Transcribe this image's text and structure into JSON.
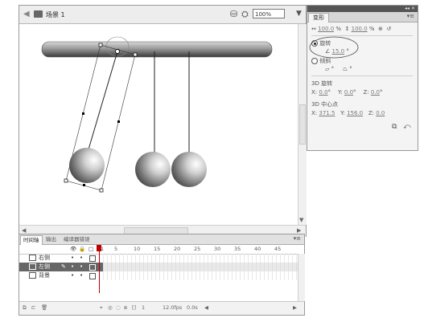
{
  "stage": {
    "back_icon": "arrow-back-icon",
    "scene_label": "场景 1",
    "zoom_value": "100%",
    "edit_symbol_icon": "edit-symbols-icon",
    "edit_scene_icon": "edit-scene-icon",
    "dropdown_icon": "chevron-down-icon"
  },
  "transform_panel": {
    "tab_label": "变形",
    "width_scale": "100.0",
    "height_scale": "100.0",
    "percent": "%",
    "rotate_label": "旋转",
    "rotate_value": "15.0",
    "degree": "°",
    "skew_label": "倾斜",
    "skew_h_value": "",
    "skew_v_value": "",
    "rotation3d_label": "3D 旋转",
    "rot_x_label": "X:",
    "rot_x_value": "0.0",
    "rot_y_label": "Y:",
    "rot_y_value": "0.0",
    "rot_z_label": "Z:",
    "rot_z_value": "0.0",
    "center3d_label": "3D 中心点",
    "center_x_label": "X:",
    "center_x_value": "371.5",
    "center_y_label": "Y:",
    "center_y_value": "156.0",
    "center_z_label": "Z:",
    "center_z_value": "0.0"
  },
  "timeline": {
    "tabs": [
      "时间轴",
      "输出",
      "编译器错误"
    ],
    "frame_numbers": [
      "1",
      "5",
      "10",
      "15",
      "20",
      "25",
      "30",
      "35",
      "40",
      "45"
    ],
    "layers": [
      {
        "name": "右侧",
        "selected": false
      },
      {
        "name": "左侧",
        "selected": true
      },
      {
        "name": "背景",
        "selected": false
      }
    ],
    "current_frame": "1",
    "fps": "12.0fps",
    "elapsed": "0.0s"
  }
}
